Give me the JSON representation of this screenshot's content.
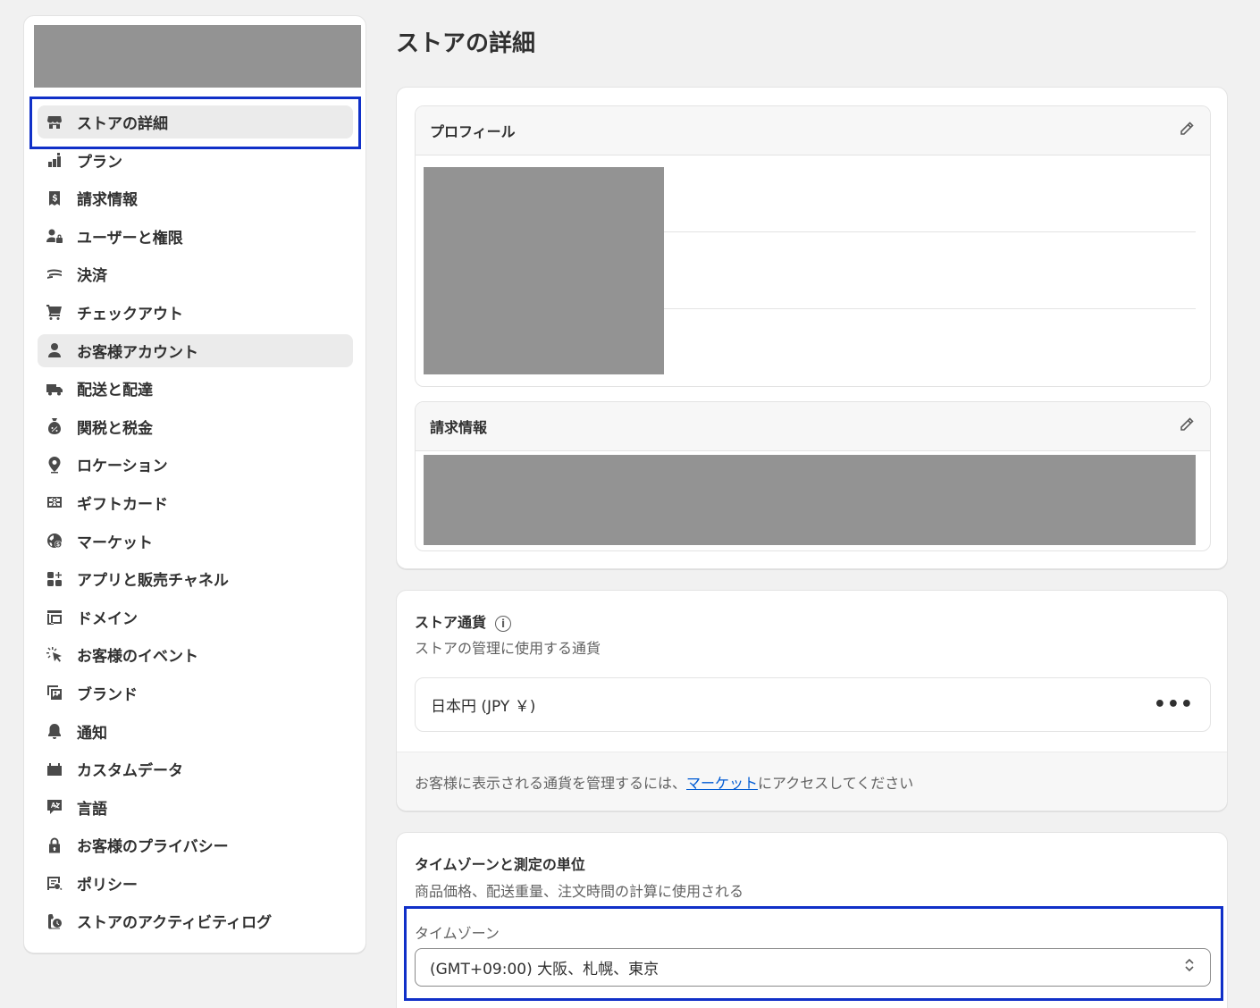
{
  "page": {
    "title": "ストアの詳細"
  },
  "sidebar": {
    "items": [
      {
        "label": "ストアの詳細",
        "icon": "store-icon",
        "active": true
      },
      {
        "label": "プラン",
        "icon": "plan-icon"
      },
      {
        "label": "請求情報",
        "icon": "billing-icon"
      },
      {
        "label": "ユーザーと権限",
        "icon": "users-icon"
      },
      {
        "label": "決済",
        "icon": "payments-icon"
      },
      {
        "label": "チェックアウト",
        "icon": "cart-icon"
      },
      {
        "label": "お客様アカウント",
        "icon": "person-icon",
        "active": true
      },
      {
        "label": "配送と配達",
        "icon": "truck-icon"
      },
      {
        "label": "関税と税金",
        "icon": "tax-icon"
      },
      {
        "label": "ロケーション",
        "icon": "location-icon"
      },
      {
        "label": "ギフトカード",
        "icon": "gift-card-icon"
      },
      {
        "label": "マーケット",
        "icon": "globe-icon"
      },
      {
        "label": "アプリと販売チャネル",
        "icon": "apps-icon"
      },
      {
        "label": "ドメイン",
        "icon": "domain-icon"
      },
      {
        "label": "お客様のイベント",
        "icon": "cursor-click-icon"
      },
      {
        "label": "ブランド",
        "icon": "image-icon"
      },
      {
        "label": "通知",
        "icon": "bell-icon"
      },
      {
        "label": "カスタムデータ",
        "icon": "database-icon"
      },
      {
        "label": "言語",
        "icon": "language-icon"
      },
      {
        "label": "お客様のプライバシー",
        "icon": "lock-icon"
      },
      {
        "label": "ポリシー",
        "icon": "policy-icon"
      },
      {
        "label": "ストアのアクティビティログ",
        "icon": "activity-log-icon"
      }
    ]
  },
  "profile_card": {
    "profile_title": "プロフィール",
    "billing_title": "請求情報"
  },
  "currency_card": {
    "title": "ストア通貨",
    "info_icon": "i",
    "subtitle": "ストアの管理に使用する通貨",
    "currency_value": "日本円 (JPY ￥)",
    "more_label": "•••",
    "footer_prefix": "お客様に表示される通貨を管理するには、",
    "footer_link": "マーケット",
    "footer_suffix": "にアクセスしてください"
  },
  "timezone_card": {
    "title": "タイムゾーンと測定の単位",
    "subtitle": "商品価格、配送重量、注文時間の計算に使用される",
    "timezone_label": "タイムゾーン",
    "timezone_value": "(GMT+09:00) 大阪、札幌、東京"
  },
  "colors": {
    "background": "#f1f1f1",
    "highlight": "#1030c8",
    "link": "#005bd3",
    "redacted": "#939393"
  }
}
